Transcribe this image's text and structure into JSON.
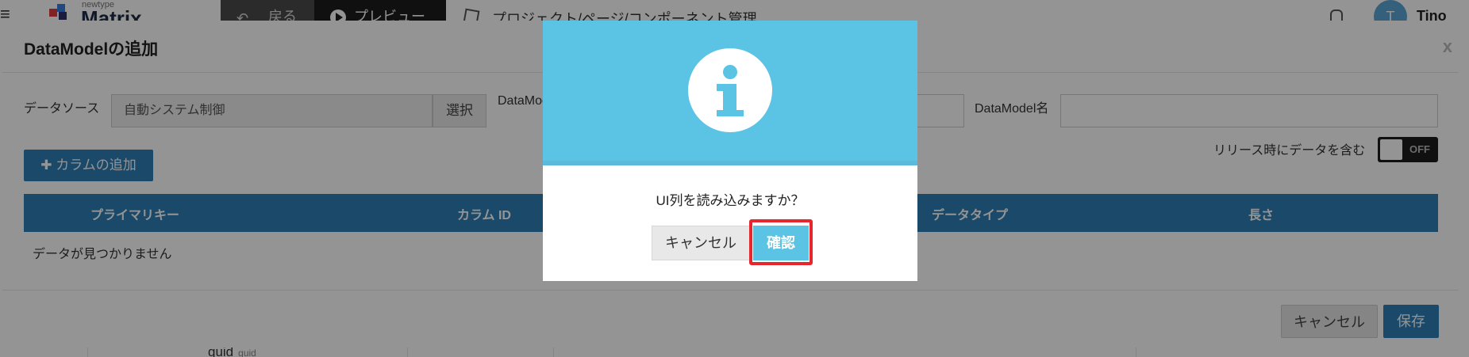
{
  "topbar": {
    "menu_glyph": "≡",
    "logo_small": "newtype",
    "logo_text": "Matrix",
    "back_label": "戻る",
    "preview_label": "プレビュー",
    "project_title": "プロジェクト/ページ/コンポーネント管理",
    "avatar_initial": "T",
    "user_name": "Tino"
  },
  "background_row": {
    "cell_text": "guid",
    "cell_sub": "guid"
  },
  "dialog": {
    "title": "DataModelの追加",
    "close_label": "x",
    "datasource_label": "データソース",
    "datasource_value": "自動システム制御",
    "select_label": "選択",
    "datamodel_id_label": "DataModelID",
    "datamodel_name_label": "DataModel名",
    "add_column_label": "✚ カラムの追加",
    "release_label": "リリース時にデータを含む",
    "toggle_state": "OFF",
    "table": {
      "headers": [
        "プライマリキー",
        "カラム ID",
        "データタイプ",
        "長さ"
      ],
      "empty_text": "データが見つかりません"
    },
    "footer": {
      "cancel_label": "キャンセル",
      "save_label": "保存"
    }
  },
  "confirm": {
    "icon": "info-icon",
    "message": "UI列を読み込みますか？",
    "cancel_label": "キャンセル",
    "ok_label": "確認"
  },
  "colors": {
    "primary": "#2d7fb5",
    "info": "#5bc3e3",
    "highlight": "#e8262e"
  }
}
